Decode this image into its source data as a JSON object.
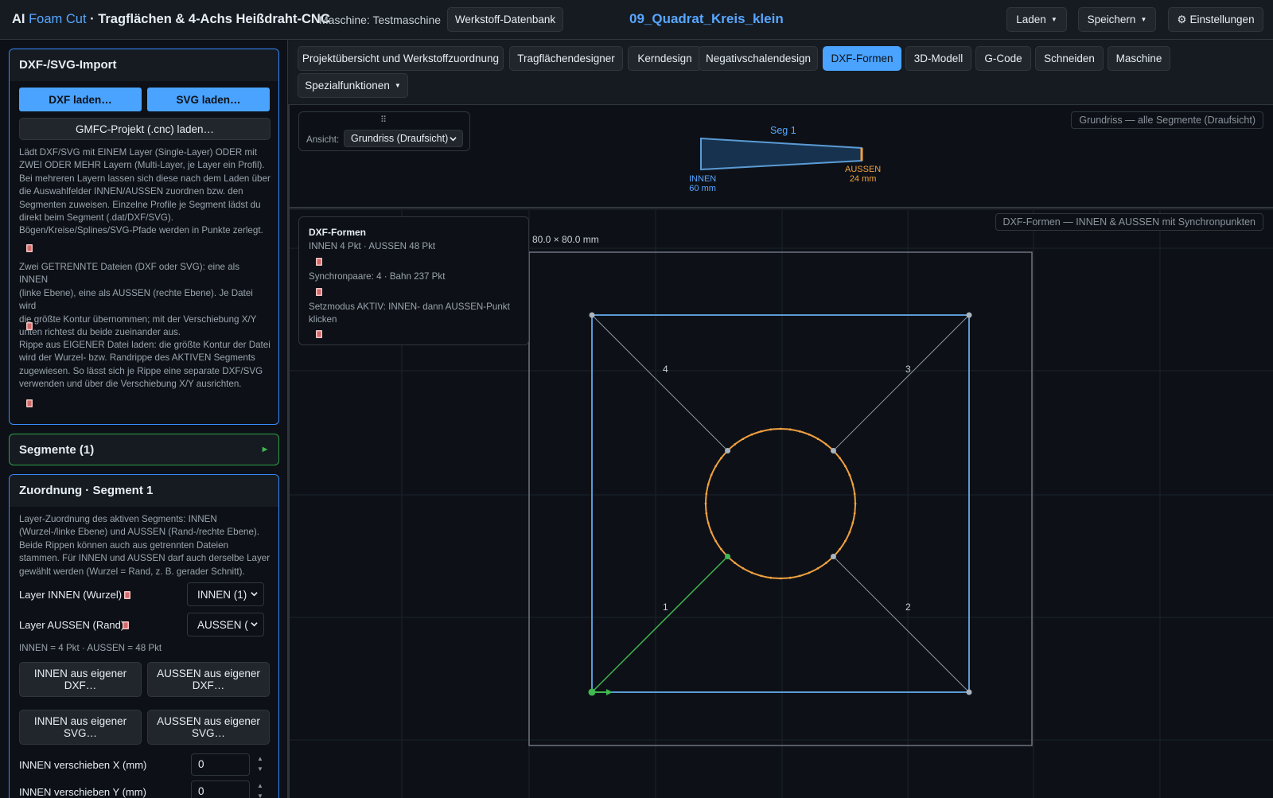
{
  "header": {
    "brand_prefix": "AI ",
    "brand_highlight": "Foam Cut",
    "brand_suffix": " · Tragflächen & 4-Achs Heißdraht-CNC",
    "machine": "Maschine: Testmaschine",
    "material_db_button": "Werkstoff-Datenbank",
    "project_title": "09_Quadrat_Kreis_klein",
    "load_button": "Laden",
    "save_button": "Speichern",
    "settings_button": "Einstellungen"
  },
  "import_panel": {
    "title": "DXF-/SVG-Import",
    "dxf_button": "DXF laden…",
    "svg_button": "SVG laden…",
    "gmfc_button": "GMFC-Projekt (.cnc) laden…",
    "text1_lines": [
      "Lädt DXF/SVG mit EINEM Layer (Single-Layer) ODER mit",
      "ZWEI ODER MEHR Layern (Multi-Layer, je Layer ein Profil).",
      "Bei mehreren Layern lassen sich diese nach dem Laden über",
      "die Auswahlfelder INNEN/AUSSEN zuordnen bzw. den",
      "Segmenten zuweisen. Einzelne Profile je Segment lädst du",
      "direkt beim Segment (.dat/DXF/SVG).",
      "Bögen/Kreise/Splines/SVG-Pfade werden in Punkte zerlegt."
    ],
    "text2_lines": [
      "Zwei GETRENNTE Dateien (DXF oder SVG): eine als INNEN",
      "(linke Ebene), eine als AUSSEN (rechte Ebene). Je Datei wird",
      "die größte Kontur übernommen; mit der Verschiebung X/Y",
      "unten richtest du beide zueinander aus."
    ],
    "text3_lines": [
      "Rippe aus EIGENER Datei laden: die größte Kontur der Datei",
      "wird der Wurzel- bzw. Randrippe des AKTIVEN Segments",
      "zugewiesen. So lässt sich je Rippe eine separate DXF/SVG",
      "verwenden und über die Verschiebung X/Y ausrichten."
    ]
  },
  "segments_panel": {
    "title": "Segmente (1)"
  },
  "assignment_panel": {
    "title": "Zuordnung · Segment 1",
    "text_lines": [
      "Layer-Zuordnung des aktiven Segments: INNEN",
      "(Wurzel-/linke Ebene) und AUSSEN (Rand-/rechte Ebene).",
      "Beide Rippen können auch aus getrennten Dateien",
      "stammen. Für INNEN und AUSSEN darf auch derselbe Layer",
      "gewählt werden (Wurzel = Rand, z. B. gerader Schnitt)."
    ],
    "layer_inner_label": "Layer INNEN (Wurzel)",
    "layer_inner_value": "INNEN (1)",
    "layer_outer_label": "Layer AUSSEN (Rand)",
    "layer_outer_value": "AUSSEN (",
    "counts": "INNEN = 4 Pkt · AUSSEN = 48 Pkt",
    "inner_dxf_l1": "INNEN aus eigener",
    "inner_dxf_l2": "DXF…",
    "outer_dxf_l1": "AUSSEN aus eigener",
    "outer_dxf_l2": "DXF…",
    "inner_svg_l1": "INNEN aus eigener",
    "inner_svg_l2": "SVG…",
    "outer_svg_l1": "AUSSEN aus eigener",
    "outer_svg_l2": "SVG…",
    "shift_x_label": "INNEN verschieben X (mm)",
    "shift_x_value": "0",
    "shift_y_label": "INNEN verschieben Y (mm)",
    "shift_y_value": "0"
  },
  "tabs": [
    {
      "label": "Projektübersicht und Werkstoffzuordnung",
      "active": false
    },
    {
      "label": "Tragflächendesigner",
      "active": false
    },
    {
      "label": "Kerndesign",
      "active": false
    },
    {
      "label": "Negativschalendesign",
      "active": false
    },
    {
      "label": "DXF-Formen",
      "active": true
    },
    {
      "label": "3D-Modell",
      "active": false
    },
    {
      "label": "G-Code",
      "active": false
    },
    {
      "label": "Schneiden",
      "active": false
    },
    {
      "label": "Maschine",
      "active": false
    },
    {
      "label": "Spezialfunktionen",
      "active": false
    }
  ],
  "top_view": {
    "view_label": "Ansicht:",
    "view_select": "Grundriss (Draufsicht)",
    "corner_label": "Grundriss — alle Segmente (Draufsicht)",
    "segment_label": "Seg 1",
    "inner_label": "INNEN",
    "inner_value": "60 mm",
    "outer_label": "AUSSEN",
    "outer_value": "24 mm"
  },
  "main_view": {
    "corner_label": "DXF-Formen — INNEN & AUSSEN mit Synchronpunkten",
    "info_title": "DXF-Formen",
    "info_line1": "INNEN 4 Pkt · AUSSEN 48 Pkt",
    "info_line2": "Synchronpaare: 4 · Bahn 237 Pkt",
    "info_line3a": "Setzmodus AKTIV: INNEN- dann AUSSEN-Punkt",
    "info_line3b": "klicken",
    "dimension_label": "80.0 × 80.0 mm",
    "pair_labels": [
      "1",
      "2",
      "3",
      "4"
    ]
  },
  "colors": {
    "accent": "#4aa3ff",
    "inner": "#5b9bd5",
    "outer": "#f0a040",
    "sync": "#3fb950",
    "connector": "#8b949e"
  },
  "icons": {
    "settings": "gear-icon",
    "doc": "document-icon",
    "drag": "drag-handle-icon"
  }
}
